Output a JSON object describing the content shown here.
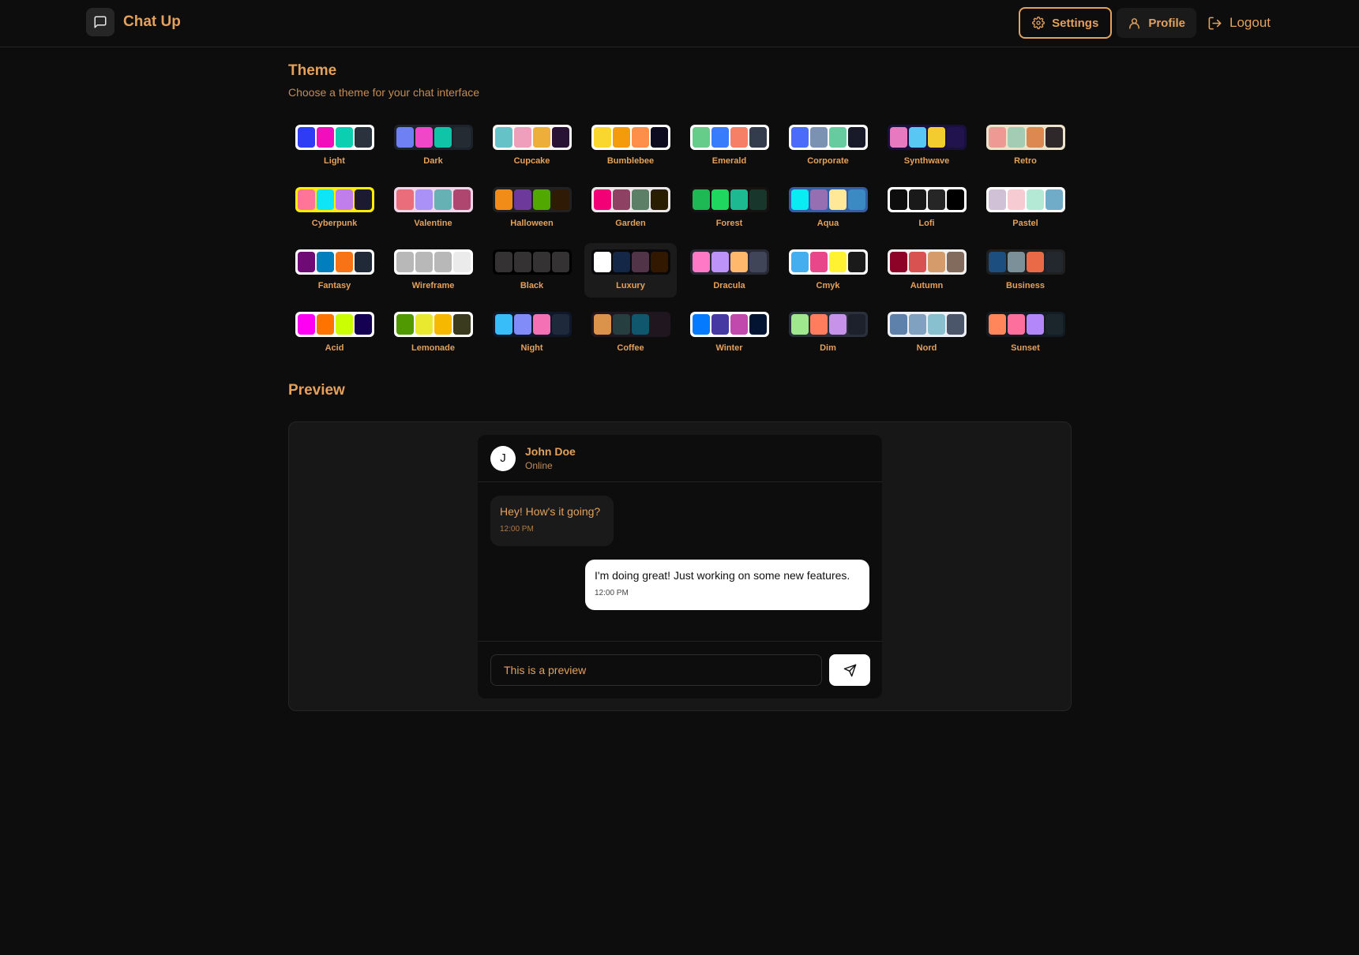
{
  "header": {
    "app_name": "Chat Up",
    "settings_label": "Settings",
    "profile_label": "Profile",
    "logout_label": "Logout"
  },
  "theme": {
    "title": "Theme",
    "subtitle": "Choose a theme for your chat interface",
    "selected": "Luxury",
    "items": [
      {
        "name": "Light",
        "colors": [
          "#2f3cf5",
          "#f10fbd",
          "#0acfb0",
          "#2a323d"
        ],
        "bg": "#ffffff"
      },
      {
        "name": "Dark",
        "colors": [
          "#6f80f5",
          "#f046c8",
          "#10c4a8",
          "#252b33"
        ],
        "bg": "#1d232a"
      },
      {
        "name": "Cupcake",
        "colors": [
          "#65c3c8",
          "#ef9fbc",
          "#eeaf3a",
          "#291334"
        ],
        "bg": "#faf7f5"
      },
      {
        "name": "Bumblebee",
        "colors": [
          "#f9d72f",
          "#f49b0b",
          "#fd8f4a",
          "#0d0a1f"
        ],
        "bg": "#ffffff"
      },
      {
        "name": "Emerald",
        "colors": [
          "#66cc8a",
          "#377cfb",
          "#f68067",
          "#333c4d"
        ],
        "bg": "#ffffff"
      },
      {
        "name": "Corporate",
        "colors": [
          "#4b6bfb",
          "#7b92b2",
          "#67cba0",
          "#181a2a"
        ],
        "bg": "#ffffff"
      },
      {
        "name": "Synthwave",
        "colors": [
          "#e779c1",
          "#58c7f3",
          "#f3cc30",
          "#20134e"
        ],
        "bg": "#1a103d"
      },
      {
        "name": "Retro",
        "colors": [
          "#ef9995",
          "#a4cbb4",
          "#dc8850",
          "#2e282a"
        ],
        "bg": "#ece3ca"
      },
      {
        "name": "Cyberpunk",
        "colors": [
          "#ff7598",
          "#0ee6f7",
          "#c07eec",
          "#1b1a30"
        ],
        "bg": "#ffee00"
      },
      {
        "name": "Valentine",
        "colors": [
          "#e96d7b",
          "#a991f7",
          "#66b1b3",
          "#af4670"
        ],
        "bg": "#f0d6e8"
      },
      {
        "name": "Halloween",
        "colors": [
          "#f28c18",
          "#6d3a9c",
          "#51a800",
          "#2f1b05"
        ],
        "bg": "#212121"
      },
      {
        "name": "Garden",
        "colors": [
          "#f40076",
          "#8e4162",
          "#5c7f67",
          "#291e00"
        ],
        "bg": "#e9e7e7"
      },
      {
        "name": "Forest",
        "colors": [
          "#1eb854",
          "#1fd65f",
          "#1db990",
          "#19362d"
        ],
        "bg": "#171212"
      },
      {
        "name": "Aqua",
        "colors": [
          "#09ecf3",
          "#966fb3",
          "#ffe999",
          "#3b8ac4"
        ],
        "bg": "#345da7"
      },
      {
        "name": "Lofi",
        "colors": [
          "#0d0d0d",
          "#1a1919",
          "#262626",
          "#000000"
        ],
        "bg": "#ffffff"
      },
      {
        "name": "Pastel",
        "colors": [
          "#d1c1d7",
          "#f6cbd1",
          "#b4e9d6",
          "#70acc7"
        ],
        "bg": "#ffffff"
      },
      {
        "name": "Fantasy",
        "colors": [
          "#6e0b75",
          "#007ebd",
          "#f87315",
          "#1f2937"
        ],
        "bg": "#ffffff"
      },
      {
        "name": "Wireframe",
        "colors": [
          "#b8b8b8",
          "#b8b8b8",
          "#b8b8b8",
          "#ebebeb"
        ],
        "bg": "#ffffff"
      },
      {
        "name": "Black",
        "colors": [
          "#343232",
          "#343232",
          "#343232",
          "#343232"
        ],
        "bg": "#000000"
      },
      {
        "name": "Luxury",
        "colors": [
          "#ffffff",
          "#152747",
          "#513448",
          "#331800"
        ],
        "bg": "#09090b"
      },
      {
        "name": "Dracula",
        "colors": [
          "#ff79c6",
          "#bd93f9",
          "#ffb86c",
          "#414558"
        ],
        "bg": "#282a36"
      },
      {
        "name": "Cmyk",
        "colors": [
          "#45aeee",
          "#e8488a",
          "#fff232",
          "#1a1a1a"
        ],
        "bg": "#ffffff"
      },
      {
        "name": "Autumn",
        "colors": [
          "#8c0327",
          "#d85251",
          "#d59b6a",
          "#826a5c"
        ],
        "bg": "#f1f1f1"
      },
      {
        "name": "Business",
        "colors": [
          "#1c4e80",
          "#7c909a",
          "#ea6947",
          "#23282e"
        ],
        "bg": "#202020"
      },
      {
        "name": "Acid",
        "colors": [
          "#ff00f4",
          "#ff7400",
          "#cbfd03",
          "#140152"
        ],
        "bg": "#fafafa"
      },
      {
        "name": "Lemonade",
        "colors": [
          "#519903",
          "#e9e92f",
          "#f6b800",
          "#3a3a1f"
        ],
        "bg": "#ffffff"
      },
      {
        "name": "Night",
        "colors": [
          "#38bdf8",
          "#818cf8",
          "#f471b5",
          "#1e293b"
        ],
        "bg": "#0f172a"
      },
      {
        "name": "Coffee",
        "colors": [
          "#db924b",
          "#263e3f",
          "#10576d",
          "#20161f"
        ],
        "bg": "#20161f"
      },
      {
        "name": "Winter",
        "colors": [
          "#047aff",
          "#463aa2",
          "#c148ac",
          "#021431"
        ],
        "bg": "#ffffff"
      },
      {
        "name": "Dim",
        "colors": [
          "#9fe88d",
          "#ff7d5c",
          "#c792e9",
          "#1c212b"
        ],
        "bg": "#2a303c"
      },
      {
        "name": "Nord",
        "colors": [
          "#5e81ac",
          "#81a1c1",
          "#88c0d0",
          "#4c566a"
        ],
        "bg": "#eceff4"
      },
      {
        "name": "Sunset",
        "colors": [
          "#ff865b",
          "#fd6f9c",
          "#b387fa",
          "#1b262c"
        ],
        "bg": "#121c22"
      }
    ]
  },
  "preview": {
    "title": "Preview",
    "contact_initial": "J",
    "contact_name": "John Doe",
    "contact_status": "Online",
    "messages": [
      {
        "text": "Hey! How's it going?",
        "time": "12:00 PM",
        "sent": false
      },
      {
        "text": "I'm doing great! Just working on some new features.",
        "time": "12:00 PM",
        "sent": true
      }
    ],
    "input_value": "This is a preview"
  },
  "colors": {
    "accent": "#e4a15c",
    "background": "#0d0d0d"
  }
}
